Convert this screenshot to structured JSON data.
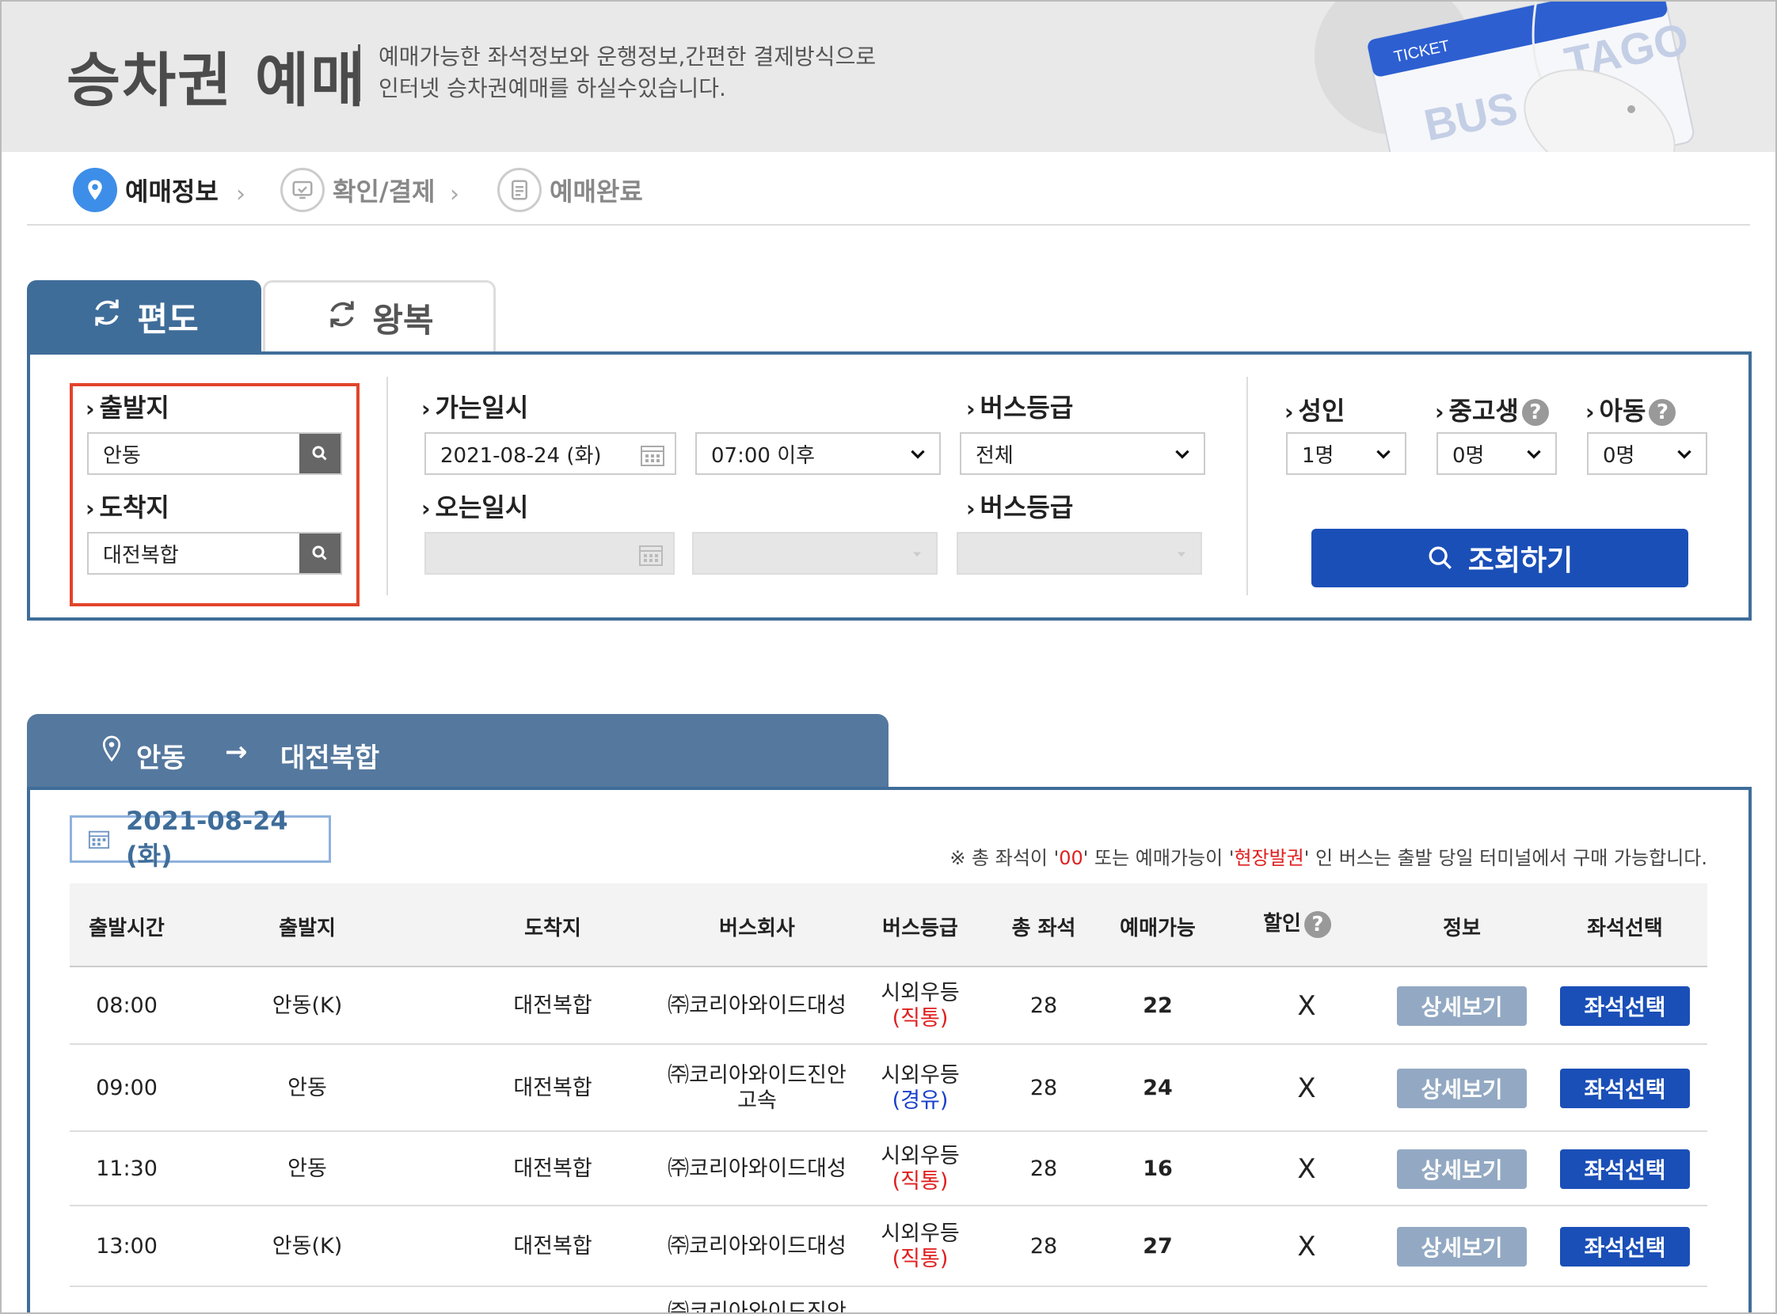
{
  "header": {
    "title": "승차권 예매",
    "desc_line1": "예매가능한 좌석정보와 운행정보,간편한 결제방식으로",
    "desc_line2": "인터넷 승차권예매를 하실수있습니다.",
    "deco_ticket": "TICKET",
    "deco_bus": "BUS",
    "deco_tago": "TAGO"
  },
  "steps": [
    {
      "label": "예매정보"
    },
    {
      "label": "확인/결제"
    },
    {
      "label": "예매완료"
    }
  ],
  "tabs": {
    "oneway": "편도",
    "roundtrip": "왕복"
  },
  "search": {
    "departure_label": "출발지",
    "departure_value": "안동",
    "arrival_label": "도착지",
    "arrival_value": "대전복합",
    "go_date_label": "가는일시",
    "go_date_value": "2021-08-24 (화)",
    "go_time_value": "07:00 이후",
    "bus_grade_label": "버스등급",
    "bus_grade_value": "전체",
    "return_date_label": "오는일시",
    "return_grade_label": "버스등급",
    "adult_label": "성인",
    "adult_value": "1명",
    "student_label": "중고생",
    "student_value": "0명",
    "child_label": "아동",
    "child_value": "0명",
    "query_button": "조회하기"
  },
  "route": {
    "from": "안동",
    "to": "대전복합"
  },
  "results": {
    "date": "2021-08-24 (화)",
    "notice_pre": "※ 총 좌석이 '",
    "notice_r1": "00",
    "notice_mid": "' 또는 예매가능이 '",
    "notice_r2": "현장발권",
    "notice_post": "' 인 버스는 출발 당일 터미널에서 구매 가능합니다.",
    "columns": [
      "출발시간",
      "출발지",
      "도착지",
      "버스회사",
      "버스등급",
      "총 좌석",
      "예매가능",
      "할인",
      "정보",
      "좌석선택"
    ],
    "detail_label": "상세보기",
    "seat_label": "좌석선택",
    "rows": [
      {
        "time": "08:00",
        "from": "안동(K)",
        "to": "대전복합",
        "company": "㈜코리아와이드대성",
        "company2": "",
        "grade": "시외우등",
        "route_type": "(직통)",
        "route_color": "red",
        "total": "28",
        "avail": "22",
        "discount": "X"
      },
      {
        "time": "09:00",
        "from": "안동",
        "to": "대전복합",
        "company": "㈜코리아와이드진안",
        "company2": "고속",
        "grade": "시외우등",
        "route_type": "(경유)",
        "route_color": "blue",
        "total": "28",
        "avail": "24",
        "discount": "X"
      },
      {
        "time": "11:30",
        "from": "안동",
        "to": "대전복합",
        "company": "㈜코리아와이드대성",
        "company2": "",
        "grade": "시외우등",
        "route_type": "(직통)",
        "route_color": "red",
        "total": "28",
        "avail": "16",
        "discount": "X"
      },
      {
        "time": "13:00",
        "from": "안동(K)",
        "to": "대전복합",
        "company": "㈜코리아와이드대성",
        "company2": "",
        "grade": "시외우등",
        "route_type": "(직통)",
        "route_color": "red",
        "total": "28",
        "avail": "27",
        "discount": "X"
      }
    ],
    "partial_row_company": "㈜코리아와이드진안"
  }
}
